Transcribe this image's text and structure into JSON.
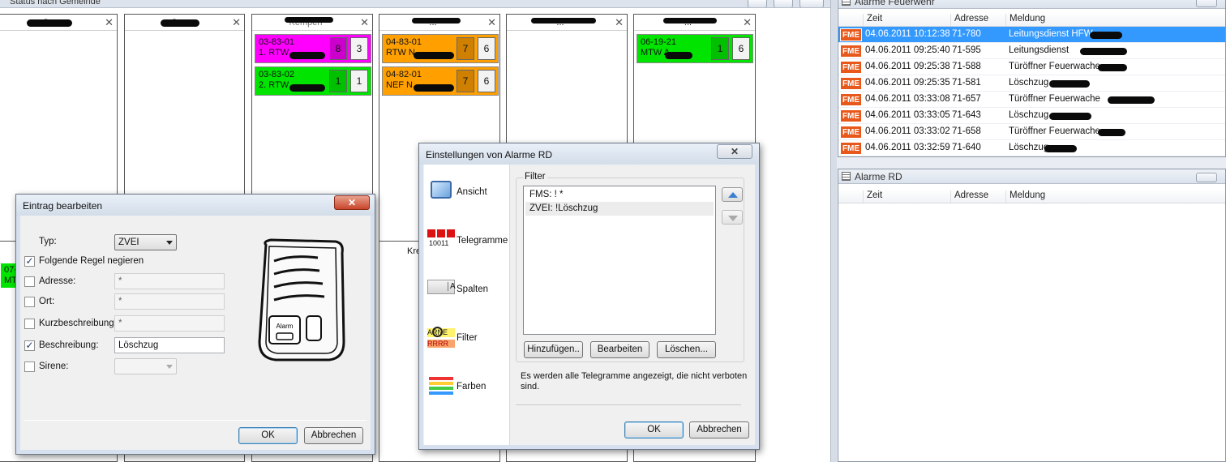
{
  "status_panel": {
    "title": "Status nach Gemeinde",
    "columns": [
      {
        "name": "Gr...",
        "vehicles": []
      },
      {
        "name": "G...",
        "vehicles": []
      },
      {
        "name": "Kempen",
        "vehicles": [
          {
            "id": "03-83-01",
            "name": "1. RTW",
            "status_a": "8",
            "status_b": "3",
            "color": "#ff00ff",
            "status_color": "#cc00cc"
          },
          {
            "id": "03-83-02",
            "name": "2. RTW",
            "status_a": "1",
            "status_b": "1",
            "color": "#00e400",
            "status_color": "#00c000"
          }
        ]
      },
      {
        "name": "...",
        "vehicles": [
          {
            "id": "04-83-01",
            "name": "RTW N...",
            "status_a": "7",
            "status_b": "6",
            "color": "#ffa000",
            "status_color": "#d08000"
          },
          {
            "id": "04-82-01",
            "name": "NEF N...",
            "status_a": "7",
            "status_b": "6",
            "color": "#ffa000",
            "status_color": "#d08000"
          }
        ]
      },
      {
        "name": "...",
        "vehicles": []
      },
      {
        "name": "...",
        "vehicles": [
          {
            "id": "06-19-21",
            "name": "MTW A...",
            "status_a": "1",
            "status_b": "6",
            "color": "#00e400",
            "status_color": "#00c000"
          }
        ]
      }
    ],
    "lower": {
      "partial_label": "Kre",
      "left_vehicle_line1": "07-",
      "left_vehicle_line2": "MT"
    }
  },
  "alarme_feuerwehr": {
    "title": "Alarme Feuerwehr",
    "headers": {
      "zeit": "Zeit",
      "adresse": "Adresse",
      "meldung": "Meldung"
    },
    "rows": [
      {
        "badge": "FME",
        "zeit": "04.06.2011 10:12:38",
        "adresse": "71-780",
        "meldung": "Leitungsdienst HFW",
        "selected": true
      },
      {
        "badge": "FME",
        "zeit": "04.06.2011 09:25:40",
        "adresse": "71-595",
        "meldung": "Leitungsdienst",
        "selected": false
      },
      {
        "badge": "FME",
        "zeit": "04.06.2011 09:25:38",
        "adresse": "71-588",
        "meldung": "Türöffner Feuerwache",
        "selected": false
      },
      {
        "badge": "FME",
        "zeit": "04.06.2011 09:25:35",
        "adresse": "71-581",
        "meldung": "Löschzug",
        "selected": false
      },
      {
        "badge": "FME",
        "zeit": "04.06.2011 03:33:08",
        "adresse": "71-657",
        "meldung": "Türöffner Feuerwache",
        "selected": false
      },
      {
        "badge": "FME",
        "zeit": "04.06.2011 03:33:05",
        "adresse": "71-643",
        "meldung": "Löschzug",
        "selected": false
      },
      {
        "badge": "FME",
        "zeit": "04.06.2011 03:33:02",
        "adresse": "71-658",
        "meldung": "Türöffner Feuerwache",
        "selected": false
      },
      {
        "badge": "FME",
        "zeit": "04.06.2011 03:32:59",
        "adresse": "71-640",
        "meldung": "Löschzug",
        "selected": false
      }
    ]
  },
  "alarme_rd": {
    "title": "Alarme RD",
    "headers": {
      "zeit": "Zeit",
      "adresse": "Adresse",
      "meldung": "Meldung"
    }
  },
  "eintrag_dialog": {
    "title": "Eintrag bearbeiten",
    "typ_label": "Typ:",
    "typ_value": "ZVEI",
    "negieren_label": "Folgende Regel negieren",
    "negieren_checked": true,
    "fields": [
      {
        "label": "Adresse:",
        "value": "*",
        "checked": false,
        "enabled": false
      },
      {
        "label": "Ort:",
        "value": "*",
        "checked": false,
        "enabled": false
      },
      {
        "label": "Kurzbeschreibung:",
        "value": "*",
        "checked": false,
        "enabled": false
      },
      {
        "label": "Beschreibung:",
        "value": "Löschzug",
        "checked": true,
        "enabled": true
      }
    ],
    "sirene_label": "Sirene:",
    "sirene_checked": false,
    "pager_button_label": "Alarm",
    "ok": "OK",
    "cancel": "Abbrechen"
  },
  "einstellungen_dialog": {
    "title": "Einstellungen von Alarme RD",
    "nav": [
      {
        "label": "Ansicht",
        "icon": "monitor-icon"
      },
      {
        "label": "Telegramme",
        "icon": "telegram-icon",
        "icon_text": "10011"
      },
      {
        "label": "Spalten",
        "icon": "columns-icon",
        "icon_text": "A"
      },
      {
        "label": "Filter",
        "icon": "filter-icon",
        "icon_text": "ARNE",
        "icon_text2": "RRRR"
      },
      {
        "label": "Farben",
        "icon": "colors-icon"
      }
    ],
    "filter_group": "Filter",
    "filters": [
      "FMS: ! *",
      "ZVEI: !Löschzug"
    ],
    "selected_filter": 1,
    "buttons": {
      "add": "Hinzufügen..",
      "edit": "Bearbeiten",
      "delete": "Löschen..."
    },
    "info": "Es werden alle Telegramme angezeigt, die nicht verboten sind.",
    "ok": "OK",
    "cancel": "Abbrechen"
  }
}
